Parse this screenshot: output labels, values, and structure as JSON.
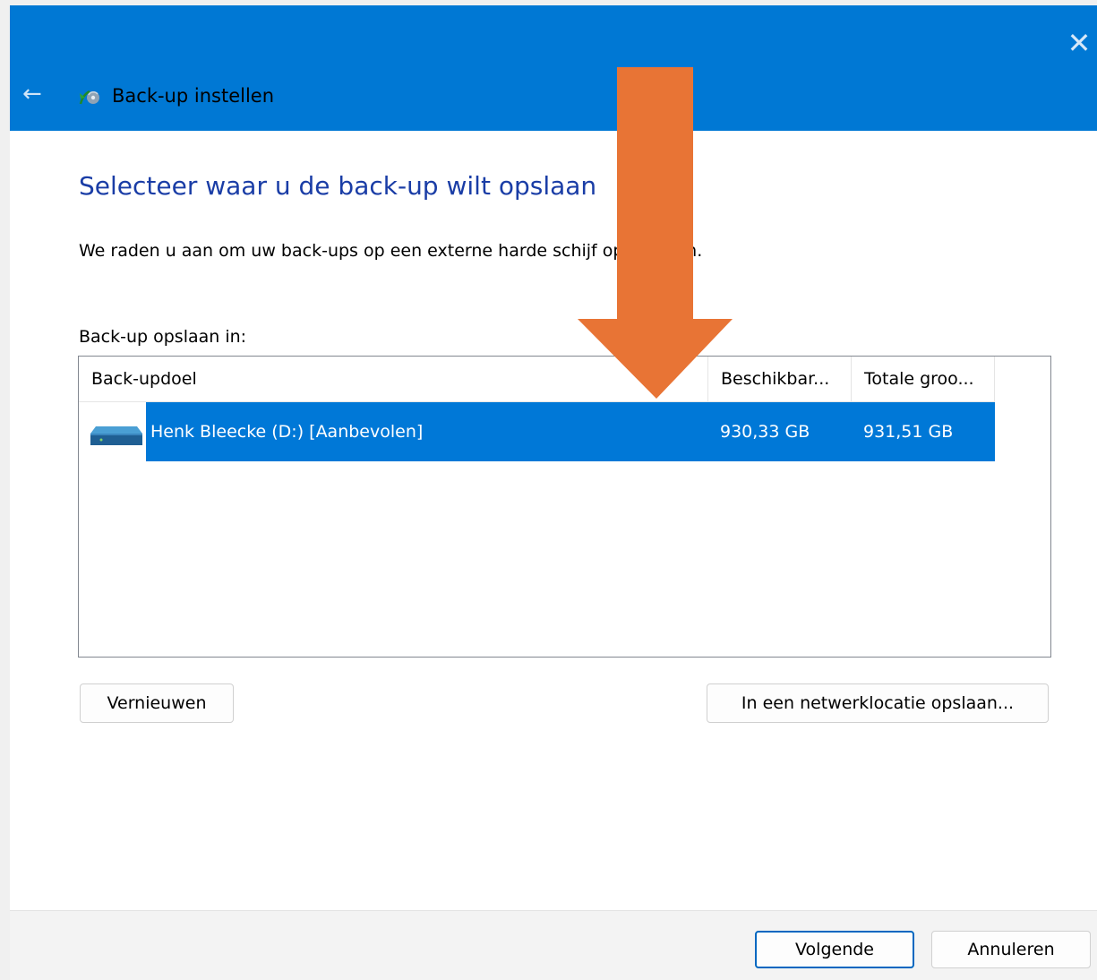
{
  "window": {
    "title": "Back-up instellen",
    "close_glyph": "✕",
    "back_glyph": "←",
    "accent_color": "#0078d4",
    "icons": [
      "back-arrow-icon",
      "backup-app-icon",
      "close-icon"
    ]
  },
  "main": {
    "heading": "Selecteer waar u de back-up wilt opslaan",
    "description": "We raden u aan om uw back-ups op een externe harde schijf op te slaan.",
    "list_label": "Back-up opslaan in:"
  },
  "list": {
    "columns": [
      "Back-updoel",
      "Beschikbar...",
      "Totale groo..."
    ],
    "rows": [
      {
        "name": "Henk Bleecke (D:) [Aanbevolen]",
        "available": "930,33 GB",
        "total": "931,51 GB",
        "selected": true,
        "icon": "drive-icon"
      }
    ],
    "selection_color": "#0078d7"
  },
  "buttons": {
    "refresh": "Vernieuwen",
    "network": "In een netwerklocatie opslaan...",
    "next": "Volgende",
    "cancel": "Annuleren"
  },
  "annotation": {
    "arrow_color": "#e87435",
    "icon": "down-arrow-annotation"
  }
}
